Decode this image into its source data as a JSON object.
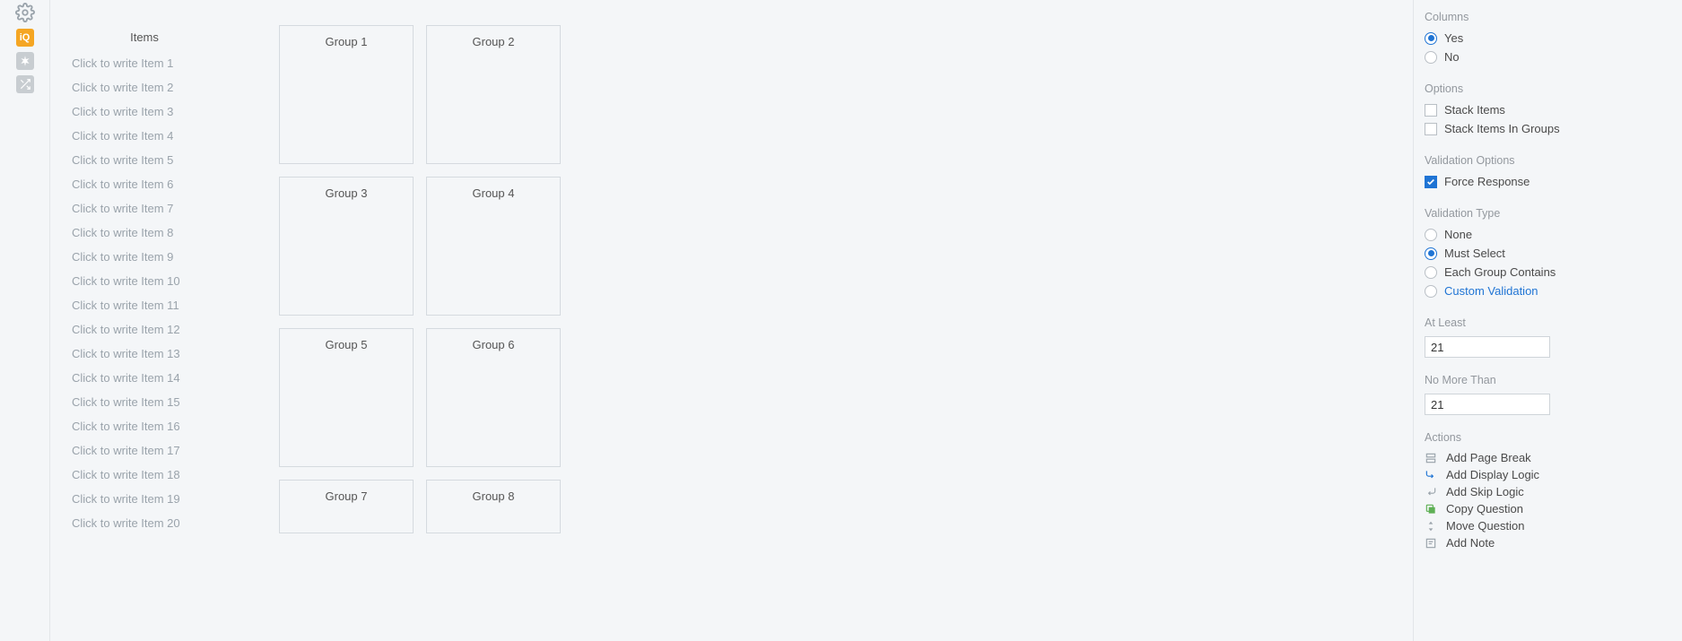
{
  "items_header": "Items",
  "items": [
    "Click to write Item 1",
    "Click to write Item 2",
    "Click to write Item 3",
    "Click to write Item 4",
    "Click to write Item 5",
    "Click to write Item 6",
    "Click to write Item 7",
    "Click to write Item 8",
    "Click to write Item 9",
    "Click to write Item 10",
    "Click to write Item 11",
    "Click to write Item 12",
    "Click to write Item 13",
    "Click to write Item 14",
    "Click to write Item 15",
    "Click to write Item 16",
    "Click to write Item 17",
    "Click to write Item 18",
    "Click to write Item 19",
    "Click to write Item 20"
  ],
  "groups": [
    "Group 1",
    "Group 2",
    "Group 3",
    "Group 4",
    "Group 5",
    "Group 6",
    "Group 7",
    "Group 8"
  ],
  "side": {
    "columns": {
      "label": "Columns",
      "yes": "Yes",
      "no": "No"
    },
    "options": {
      "label": "Options",
      "stack_items": "Stack Items",
      "stack_in_groups": "Stack Items In Groups"
    },
    "validation_options": {
      "label": "Validation Options",
      "force_response": "Force Response"
    },
    "validation_type": {
      "label": "Validation Type",
      "none": "None",
      "must_select": "Must Select",
      "each_group": "Each Group Contains",
      "custom": "Custom Validation"
    },
    "at_least": {
      "label": "At Least",
      "value": "21"
    },
    "no_more": {
      "label": "No More Than",
      "value": "21"
    },
    "actions": {
      "label": "Actions",
      "page_break": "Add Page Break",
      "display_logic": "Add Display Logic",
      "skip_logic": "Add Skip Logic",
      "copy": "Copy Question",
      "move": "Move Question",
      "note": "Add Note"
    }
  }
}
